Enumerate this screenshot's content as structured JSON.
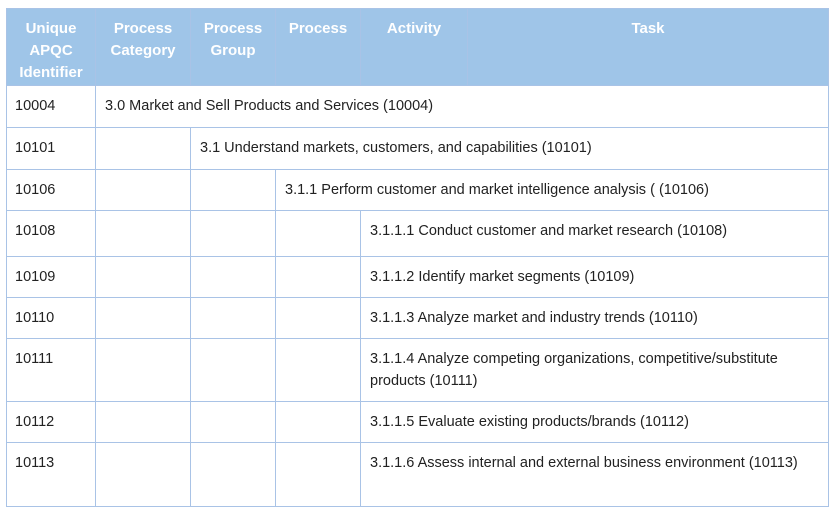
{
  "table": {
    "headers": [
      "Unique APQC Identifier",
      "Process Category",
      "Process Group",
      "Process",
      "Activity",
      "Task"
    ],
    "rows": [
      {
        "id": "10004",
        "level": 1,
        "text": "3.0 Market and Sell Products and Services (10004)"
      },
      {
        "id": "10101",
        "level": 2,
        "text": "3.1  Understand markets, customers, and capabilities  (10101)"
      },
      {
        "id": "10106",
        "level": 3,
        "text": "3.1.1 Perform customer and market intelligence analysis ( (10106)"
      },
      {
        "id": "10108",
        "level": 4,
        "text": "3.1.1.1  Conduct customer and market research  (10108)"
      },
      {
        "id": "10109",
        "level": 4,
        "text": "3.1.1.2  Identify market segments  (10109)"
      },
      {
        "id": "10110",
        "level": 4,
        "text": "3.1.1.3  Analyze market and industry trends  (10110)"
      },
      {
        "id": "10111",
        "level": 4,
        "text": "3.1.1.4 Analyze competing organizations, competitive/substitute products (10111)"
      },
      {
        "id": "10112",
        "level": 4,
        "text": "3.1.1.5  Evaluate existing products/brands  (10112)"
      },
      {
        "id": "10113",
        "level": 4,
        "text": "3.1.1.6  Assess internal and external business environment (10113)"
      }
    ]
  },
  "colors": {
    "header_bg": "#9fc5e8",
    "header_text": "#ffffff",
    "border": "#a9c3e6"
  }
}
